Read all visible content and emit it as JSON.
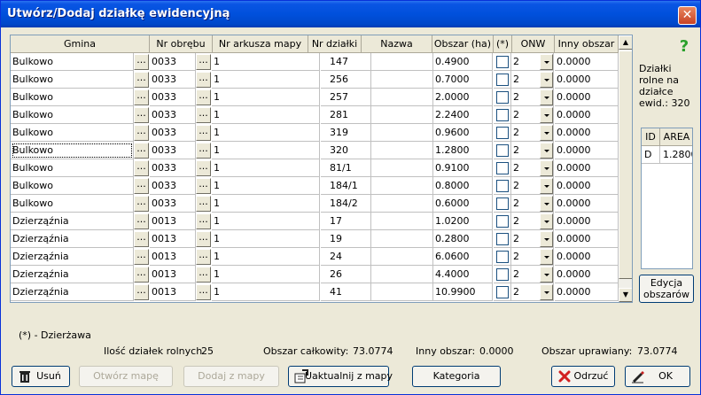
{
  "window": {
    "title": "Utwórz/Dodaj działkę ewidencyjną",
    "close_glyph": "✕"
  },
  "grid": {
    "columns": [
      "Gmina",
      "Nr obrębu",
      "Nr arkusza mapy",
      "Nr działki",
      "Nazwa",
      "Obszar (ha)",
      "(*)",
      "ONW",
      "Inny obszar"
    ],
    "ellipsis": "...",
    "rows": [
      {
        "gmina": "Bulkowo",
        "obreb": "0033",
        "arkusz": "1",
        "dzialka": "147",
        "nazwa": "",
        "obszar": "0.4900",
        "onw": "2",
        "inny": "0.0000"
      },
      {
        "gmina": "Bulkowo",
        "obreb": "0033",
        "arkusz": "1",
        "dzialka": "256",
        "nazwa": "",
        "obszar": "0.7000",
        "onw": "2",
        "inny": "0.0000"
      },
      {
        "gmina": "Bulkowo",
        "obreb": "0033",
        "arkusz": "1",
        "dzialka": "257",
        "nazwa": "",
        "obszar": "2.0000",
        "onw": "2",
        "inny": "0.0000"
      },
      {
        "gmina": "Bulkowo",
        "obreb": "0033",
        "arkusz": "1",
        "dzialka": "281",
        "nazwa": "",
        "obszar": "2.2400",
        "onw": "2",
        "inny": "0.0000"
      },
      {
        "gmina": "Bulkowo",
        "obreb": "0033",
        "arkusz": "1",
        "dzialka": "319",
        "nazwa": "",
        "obszar": "0.9600",
        "onw": "2",
        "inny": "0.0000"
      },
      {
        "gmina": "Bulkowo",
        "obreb": "0033",
        "arkusz": "1",
        "dzialka": "320",
        "nazwa": "",
        "obszar": "1.2800",
        "onw": "2",
        "inny": "0.0000",
        "active": true
      },
      {
        "gmina": "Bulkowo",
        "obreb": "0033",
        "arkusz": "1",
        "dzialka": "81/1",
        "nazwa": "",
        "obszar": "0.9100",
        "onw": "2",
        "inny": "0.0000"
      },
      {
        "gmina": "Bulkowo",
        "obreb": "0033",
        "arkusz": "1",
        "dzialka": "184/1",
        "nazwa": "",
        "obszar": "0.8000",
        "onw": "2",
        "inny": "0.0000"
      },
      {
        "gmina": "Bulkowo",
        "obreb": "0033",
        "arkusz": "1",
        "dzialka": "184/2",
        "nazwa": "",
        "obszar": "0.6000",
        "onw": "2",
        "inny": "0.0000"
      },
      {
        "gmina": "Dzierząźnia",
        "obreb": "0013",
        "arkusz": "1",
        "dzialka": "17",
        "nazwa": "",
        "obszar": "1.0200",
        "onw": "2",
        "inny": "0.0000"
      },
      {
        "gmina": "Dzierząźnia",
        "obreb": "0013",
        "arkusz": "1",
        "dzialka": "19",
        "nazwa": "",
        "obszar": "0.2800",
        "onw": "2",
        "inny": "0.0000"
      },
      {
        "gmina": "Dzierząźnia",
        "obreb": "0013",
        "arkusz": "1",
        "dzialka": "24",
        "nazwa": "",
        "obszar": "6.0600",
        "onw": "2",
        "inny": "0.0000"
      },
      {
        "gmina": "Dzierząźnia",
        "obreb": "0013",
        "arkusz": "1",
        "dzialka": "26",
        "nazwa": "",
        "obszar": "4.4000",
        "onw": "2",
        "inny": "0.0000"
      },
      {
        "gmina": "Dzierząźnia",
        "obreb": "0013",
        "arkusz": "1",
        "dzialka": "41",
        "nazwa": "",
        "obszar": "10.9900",
        "onw": "2",
        "inny": "0.0000"
      }
    ],
    "scroll_up_glyph": "▲",
    "scroll_down_glyph": "▼"
  },
  "side": {
    "help_glyph": "?",
    "rolne_label": "Działki rolne na działce ewid.:",
    "rolne_value": "320",
    "area_columns": [
      "ID",
      "AREA"
    ],
    "area_rows": [
      {
        "id": "D",
        "area": "1.2800"
      }
    ],
    "edycja_label": "Edycja obszarów"
  },
  "footer": {
    "legend": "(*) - Dzierżawa",
    "ilosc_label": "Ilość działek rolnych",
    "ilosc_value": "25",
    "calkowity_label": "Obszar całkowity:",
    "calkowity_value": "73.0774",
    "inny_label": "Inny obszar:",
    "inny_value": "0.0000",
    "uprawiany_label": "Obszar uprawiany:",
    "uprawiany_value": "73.0774"
  },
  "buttons": {
    "usun": "Usuń",
    "utworz": "Otwórz mapę",
    "dodaj": "Dodaj z mapy",
    "uaktualnij": "Uaktualnij z mapy",
    "kategoria": "Kategoria",
    "odrzuc": "Odrzuć",
    "ok": "OK"
  },
  "colors": {
    "title_bar": "#0050dc",
    "window_bg": "#ece9d8",
    "help_icon": "#2aa02a",
    "cancel_icon": "#d22020"
  },
  "icons": {
    "usun": "trash-icon",
    "uaktualnij": "map-update-icon",
    "odrzuc": "cancel-x-icon",
    "ok": "pen-ok-icon",
    "help": "question-icon"
  }
}
